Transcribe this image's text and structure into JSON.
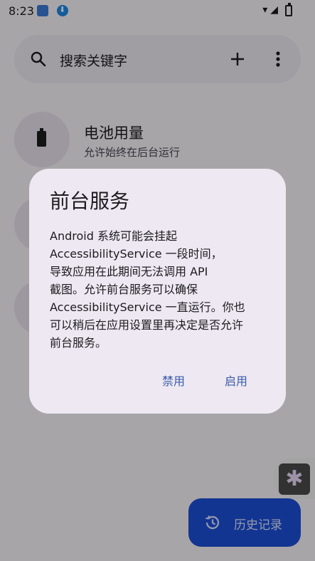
{
  "status_bar": {
    "time": "8:23"
  },
  "search": {
    "placeholder": "搜索关键字"
  },
  "list": {
    "battery": {
      "title": "电池用量",
      "subtitle": "允许始终在后台运行"
    }
  },
  "dialog": {
    "title": "前台服务",
    "body": "Android 系统可能会挂起\nAccessibilityService 一段时间，\n导致应用在此期间无法调用 API\n截图。允许前台服务可以确保\nAccessibilityService 一直运行。你也\n可以稍后在应用设置里再决定是否允许\n前台服务。",
    "disable_label": "禁用",
    "enable_label": "启用"
  },
  "fab": {
    "label": "历史记录"
  },
  "colors": {
    "accent": "#3b5ba9",
    "fab_bg": "#1d4ed8",
    "dialog_bg": "#eee8f2"
  }
}
